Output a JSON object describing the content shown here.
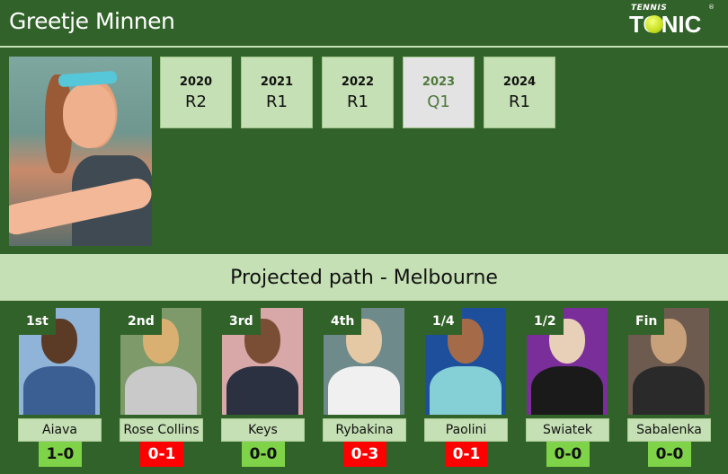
{
  "header": {
    "player_name": "Greetje Minnen",
    "logo": {
      "top": "TENNIS",
      "main": "TONIC",
      "registered": "®"
    }
  },
  "history": [
    {
      "year": "2020",
      "result": "R2",
      "highlighted": true
    },
    {
      "year": "2021",
      "result": "R1",
      "highlighted": true
    },
    {
      "year": "2022",
      "result": "R1",
      "highlighted": true
    },
    {
      "year": "2023",
      "result": "Q1",
      "highlighted": false
    },
    {
      "year": "2024",
      "result": "R1",
      "highlighted": true
    }
  ],
  "path_title": "Projected path - Melbourne",
  "opponents": [
    {
      "round": "1st",
      "name": "Aiava",
      "h2h": "1-0",
      "status": "win"
    },
    {
      "round": "2nd",
      "name": "Rose Collins",
      "h2h": "0-1",
      "status": "loss"
    },
    {
      "round": "3rd",
      "name": "Keys",
      "h2h": "0-0",
      "status": "even"
    },
    {
      "round": "4th",
      "name": "Rybakina",
      "h2h": "0-3",
      "status": "loss"
    },
    {
      "round": "1/4",
      "name": "Paolini",
      "h2h": "0-1",
      "status": "loss"
    },
    {
      "round": "1/2",
      "name": "Swiatek",
      "h2h": "0-0",
      "status": "even"
    },
    {
      "round": "Fin",
      "name": "Sabalenka",
      "h2h": "0-0",
      "status": "even"
    }
  ],
  "colors": {
    "background": "#316229",
    "light_green": "#c5e0b4",
    "win": "#7ed348",
    "loss": "#ff0000",
    "dim": "#e3e3e3"
  }
}
